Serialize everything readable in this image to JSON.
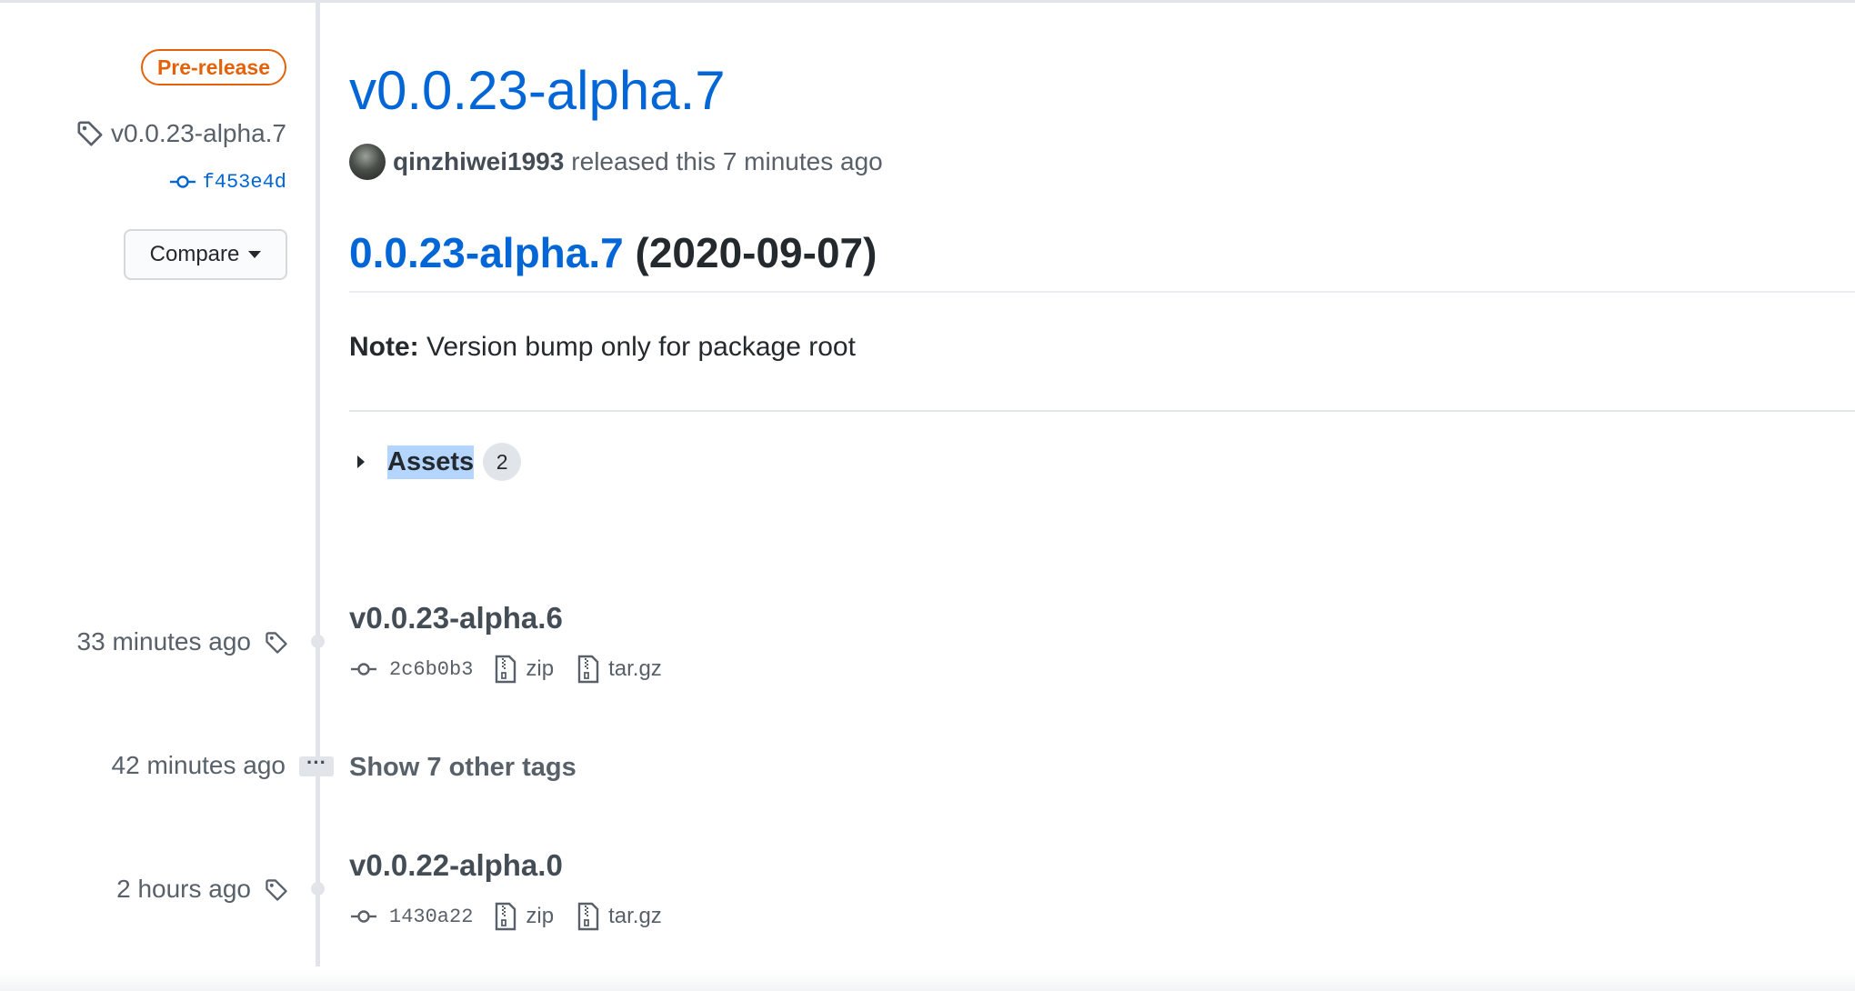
{
  "sidebar": {
    "badge": "Pre-release",
    "tag_name": "v0.0.23-alpha.7",
    "commit_sha": "f453e4d",
    "compare_label": "Compare"
  },
  "release": {
    "title": "v0.0.23-alpha.7",
    "author": "qinzhiwei1993",
    "released_text": "released this 7 minutes ago",
    "notes_heading_link": "0.0.23-alpha.7",
    "notes_heading_date": "(2020-09-07)",
    "note_label": "Note:",
    "note_text": "Version bump only for package root",
    "assets_label": "Assets",
    "assets_count": "2"
  },
  "tags": [
    {
      "time": "33 minutes ago",
      "name": "v0.0.23-alpha.6",
      "sha": "2c6b0b3",
      "zip_label": "zip",
      "targz_label": "tar.gz"
    },
    {
      "time": "2 hours ago",
      "name": "v0.0.22-alpha.0",
      "sha": "1430a22",
      "zip_label": "zip",
      "targz_label": "tar.gz"
    }
  ],
  "collapsed_group": {
    "time": "42 minutes ago",
    "ellipsis": "···",
    "label": "Show 7 other tags"
  },
  "colors": {
    "link": "#0366d6",
    "prerelease": "#e36209",
    "muted": "#586069",
    "text": "#24292e"
  },
  "icons": [
    "tag-icon",
    "git-commit-icon",
    "caret-down-icon",
    "file-zip-icon",
    "triangle-right-icon",
    "avatar"
  ]
}
